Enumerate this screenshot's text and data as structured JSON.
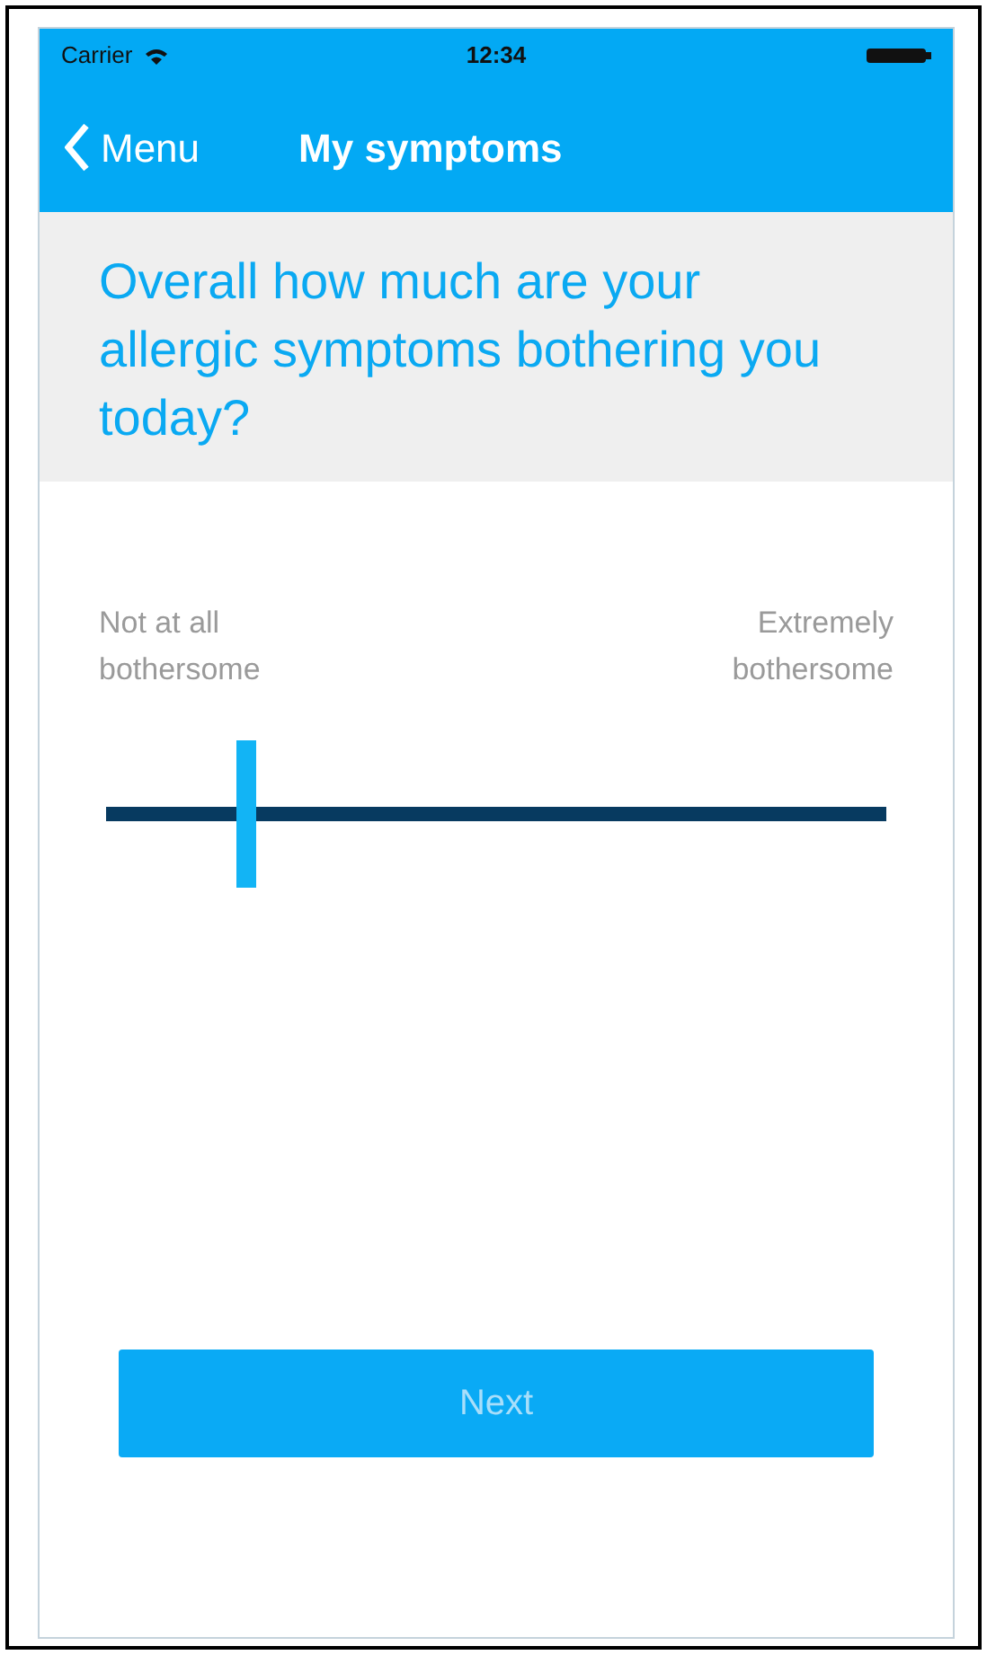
{
  "status_bar": {
    "carrier": "Carrier",
    "time": "12:34"
  },
  "nav_bar": {
    "back": "Menu",
    "title": "My symptoms"
  },
  "question": "Overall how much are your allergic symptoms bothering you today?",
  "slider": {
    "min_label": "Not at all bothersome",
    "max_label": "Extremely bothersome",
    "level": 0.18
  },
  "buttons": [
    {
      "label": "Next",
      "disabled": true
    }
  ]
}
